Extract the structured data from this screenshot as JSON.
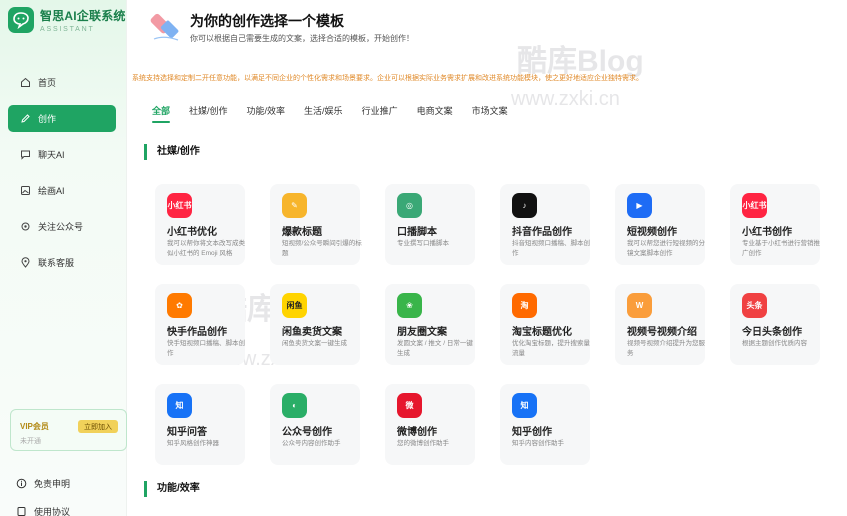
{
  "brand": {
    "name": "智思AI企联系统",
    "subtitle": "ASSISTANT"
  },
  "sidebar": {
    "items": [
      {
        "label": "首页",
        "icon": "home-icon",
        "active": false
      },
      {
        "label": "创作",
        "icon": "edit-icon",
        "active": true
      },
      {
        "label": "聊天AI",
        "icon": "chat-icon",
        "active": false
      },
      {
        "label": "绘画AI",
        "icon": "image-icon",
        "active": false
      },
      {
        "label": "关注公众号",
        "icon": "gear-icon",
        "active": false
      },
      {
        "label": "联系客服",
        "icon": "location-icon",
        "active": false
      }
    ],
    "vip": {
      "title": "VIP会员",
      "status": "未开通",
      "button": "立即加入"
    },
    "footer": [
      {
        "label": "免责申明",
        "icon": "info-icon"
      },
      {
        "label": "使用协议",
        "icon": "doc-icon"
      }
    ]
  },
  "header": {
    "title": "为你的创作选择一个模板",
    "subtitle": "你可以根据自己需要生成的文案，选择合适的模板，开始创作！"
  },
  "notice": "系统支持选择和定制二开任意功能，以满足不同企业的个性化需求和场景要求。企业可以根据实际业务需求扩展和改进系统功能模块，使之更好地适应企业独特需求。",
  "watermark": {
    "text1": "酷库Blog",
    "text2": "www.zxki.cn"
  },
  "tabs": [
    "全部",
    "社媒/创作",
    "功能/效率",
    "生活/娱乐",
    "行业推广",
    "电商文案",
    "市场文案"
  ],
  "sections": [
    {
      "title": "社媒/创作"
    },
    {
      "title": "功能/效率"
    }
  ],
  "cards": [
    {
      "title": "小红书优化",
      "desc": "我可以帮你将文本改写成类似小红书的 Emoji 风格",
      "icon_label": "小红书",
      "color": "#ff2442"
    },
    {
      "title": "爆款标题",
      "desc": "短视频/公众号瞬间引爆的标题",
      "icon_label": "✎",
      "color": "#f7b52c"
    },
    {
      "title": "口播脚本",
      "desc": "专业撰写口播脚本",
      "icon_label": "◎",
      "color": "#3aa876"
    },
    {
      "title": "抖音作品创作",
      "desc": "抖音短视频口播稿、脚本创作",
      "icon_label": "♪",
      "color": "#111111"
    },
    {
      "title": "短视频创作",
      "desc": "我可以帮您进行短视频的分镜文案脚本创作",
      "icon_label": "▶",
      "color": "#1e6cf5"
    },
    {
      "title": "小红书创作",
      "desc": "专业基于小红书进行营销推广创作",
      "icon_label": "小红书",
      "color": "#ff2442"
    },
    {
      "title": "快手作品创作",
      "desc": "快手短视频口播稿、脚本创作",
      "icon_label": "✿",
      "color": "#ff7a00"
    },
    {
      "title": "闲鱼卖货文案",
      "desc": "闲鱼卖货文案一键生成",
      "icon_label": "闲鱼",
      "color": "#ffd400"
    },
    {
      "title": "朋友圈文案",
      "desc": "发圆文案 / 推文 / 日常一键生成",
      "icon_label": "❀",
      "color": "#39b54a"
    },
    {
      "title": "淘宝标题优化",
      "desc": "优化淘宝标题，提升搜索量流量",
      "icon_label": "淘",
      "color": "#ff6a00"
    },
    {
      "title": "视频号视频介绍",
      "desc": "视频号视频介绍提升为您服务",
      "icon_label": "W",
      "color": "#fa9d3b"
    },
    {
      "title": "今日头条创作",
      "desc": "根据主题创作优质内容",
      "icon_label": "头条",
      "color": "#f04142"
    },
    {
      "title": "知乎问答",
      "desc": "知乎风格创作神器",
      "icon_label": "知",
      "color": "#1772f6"
    },
    {
      "title": "公众号创作",
      "desc": "公众号内容创作助手",
      "icon_label": "◐",
      "color": "#2aae67"
    },
    {
      "title": "微博创作",
      "desc": "您的微博创作助手",
      "icon_label": "微",
      "color": "#e6162d"
    },
    {
      "title": "知乎创作",
      "desc": "知乎内容创作助手",
      "icon_label": "知",
      "color": "#1772f6"
    }
  ]
}
